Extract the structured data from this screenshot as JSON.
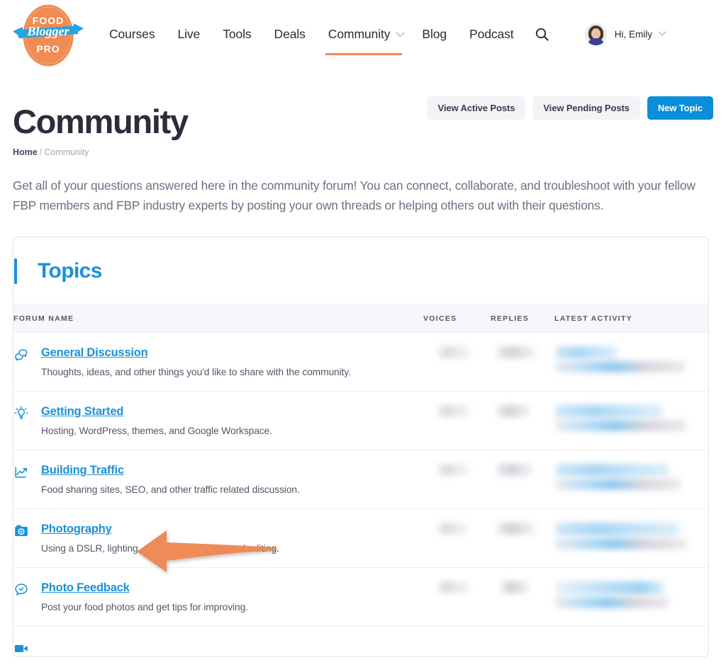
{
  "brand": {
    "logo_top_text": "FOOD",
    "logo_banner_text": "Blogger",
    "logo_bottom_text": "PRO",
    "orange": "#ee8a50",
    "blue": "#1b91d8"
  },
  "nav": {
    "items": [
      {
        "label": "Courses",
        "active": false,
        "caret": false
      },
      {
        "label": "Live",
        "active": false,
        "caret": false
      },
      {
        "label": "Tools",
        "active": false,
        "caret": false
      },
      {
        "label": "Deals",
        "active": false,
        "caret": false
      },
      {
        "label": "Community",
        "active": true,
        "caret": true
      },
      {
        "label": "Blog",
        "active": false,
        "caret": false
      },
      {
        "label": "Podcast",
        "active": false,
        "caret": false
      }
    ],
    "search_icon": "search-icon",
    "caret_glyph": "⌄"
  },
  "user": {
    "greeting": "Hi, Emily",
    "caret_glyph": "⌄",
    "avatar_icon": "user-avatar"
  },
  "page": {
    "title": "Community",
    "breadcrumb": {
      "home": "Home",
      "separator": "/",
      "current": "Community"
    },
    "intro": "Get all of your questions answered here in the community forum! You can connect, collaborate, and troubleshoot with your fellow FBP members and FBP industry experts by posting your own threads or helping others out with their questions."
  },
  "actions": {
    "view_active_posts": "View Active Posts",
    "view_pending_posts": "View Pending Posts",
    "new_topic": "New Topic"
  },
  "topics_card": {
    "title": "Topics",
    "columns": {
      "forum_name": "FORUM NAME",
      "voices": "VOICES",
      "replies": "REPLIES",
      "latest_activity": "LATEST ACTIVITY"
    },
    "rows": [
      {
        "icon": "chat-bubbles-icon",
        "name": "General Discussion",
        "description": "Thoughts, ideas, and other things you'd like to share with the community.",
        "voices": "",
        "replies": "",
        "latest_activity": ""
      },
      {
        "icon": "lightbulb-icon",
        "name": "Getting Started",
        "description": "Hosting, WordPress, themes, and Google Workspace.",
        "voices": "",
        "replies": "",
        "latest_activity": ""
      },
      {
        "icon": "chart-trend-icon",
        "name": "Building Traffic",
        "description": "Food sharing sites, SEO, and other traffic related discussion.",
        "voices": "",
        "replies": "",
        "latest_activity": ""
      },
      {
        "icon": "camera-icon",
        "name": "Photography",
        "description": "Using a DSLR, lighting, props, composition, and editing.",
        "voices": "",
        "replies": "",
        "latest_activity": ""
      },
      {
        "icon": "chat-check-icon",
        "name": "Photo Feedback",
        "description": "Post your food photos and get tips for improving.",
        "voices": "",
        "replies": "",
        "latest_activity": ""
      },
      {
        "icon": "video-camera-icon",
        "name": "",
        "description": "",
        "voices": "",
        "replies": "",
        "latest_activity": ""
      }
    ]
  },
  "annotation": {
    "type": "arrow",
    "color": "#ee8a56",
    "points_to": "Photography",
    "direction": "left"
  }
}
